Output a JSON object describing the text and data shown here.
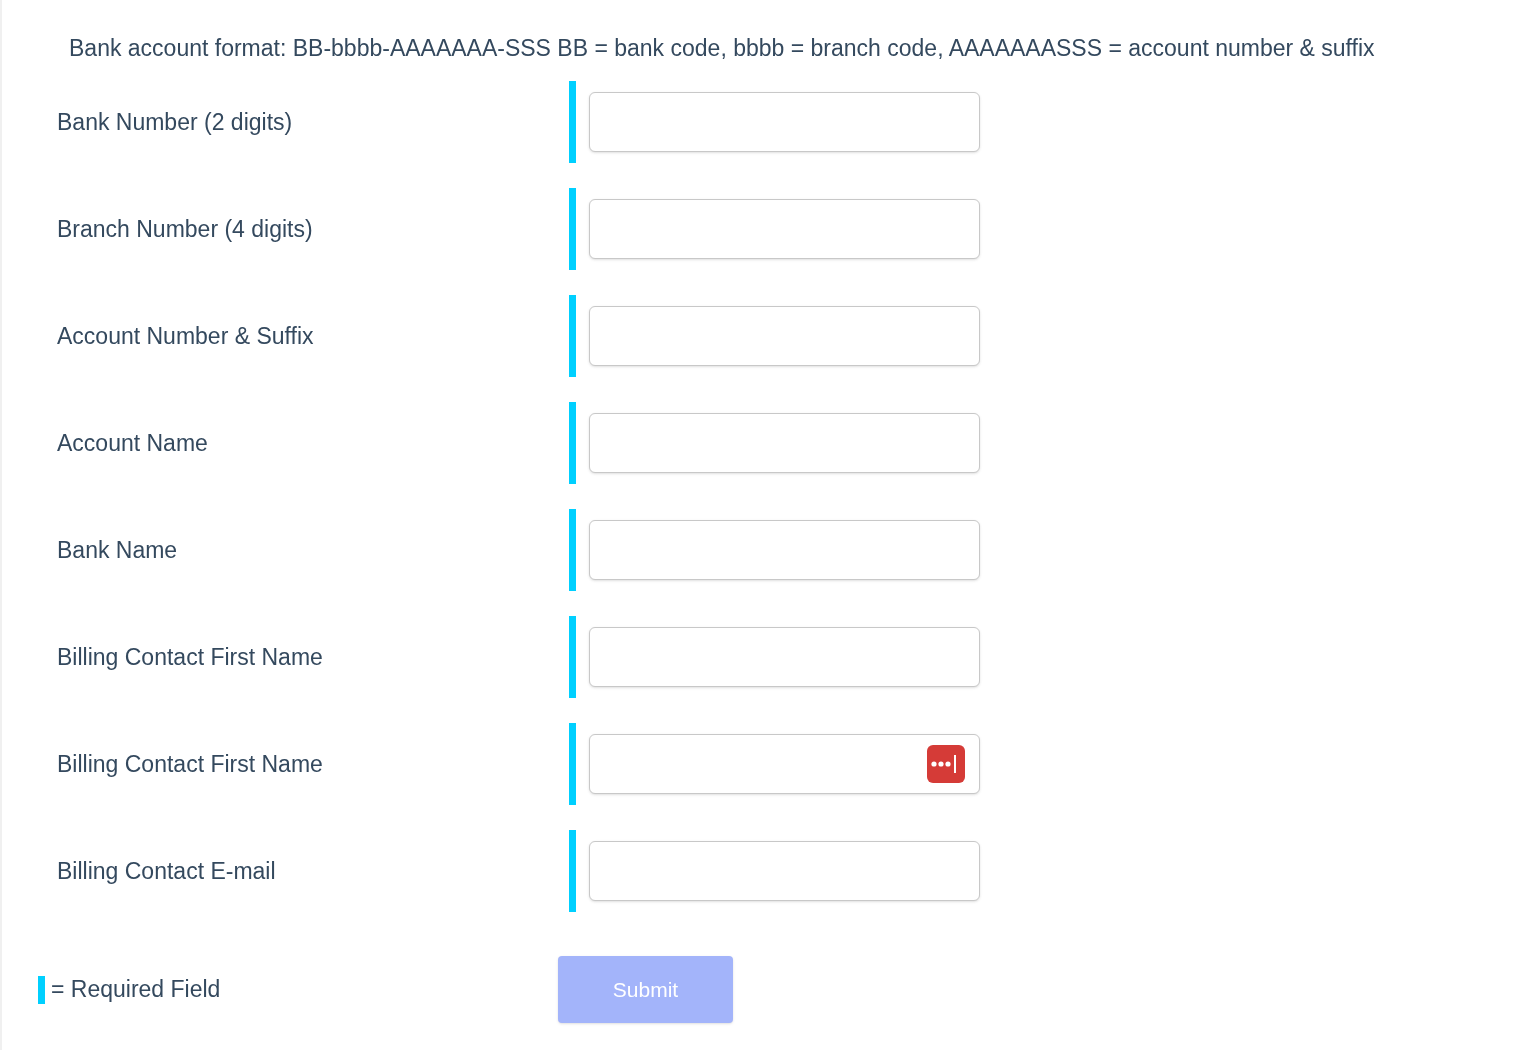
{
  "format_note": "Bank account format: BB-bbbb-AAAAAAA-SSS BB = bank code, bbbb = branch code, AAAAAAASSS = account number & suffix",
  "fields": [
    {
      "label": "Bank Number (2 digits)",
      "required": true,
      "kind": "text"
    },
    {
      "label": "Branch Number (4 digits)",
      "required": true,
      "kind": "text"
    },
    {
      "label": "Account Number & Suffix",
      "required": true,
      "kind": "text"
    },
    {
      "label": "Account Name",
      "required": true,
      "kind": "text"
    },
    {
      "label": "Bank Name",
      "required": true,
      "kind": "text"
    },
    {
      "label": "Billing Contact First Name",
      "required": true,
      "kind": "text"
    },
    {
      "label": "Billing Contact First Name",
      "required": true,
      "kind": "password-manager"
    },
    {
      "label": "Billing Contact E-mail",
      "required": true,
      "kind": "text"
    }
  ],
  "legend": "= Required Field",
  "submit": {
    "label": "Submit",
    "disabled": true
  }
}
